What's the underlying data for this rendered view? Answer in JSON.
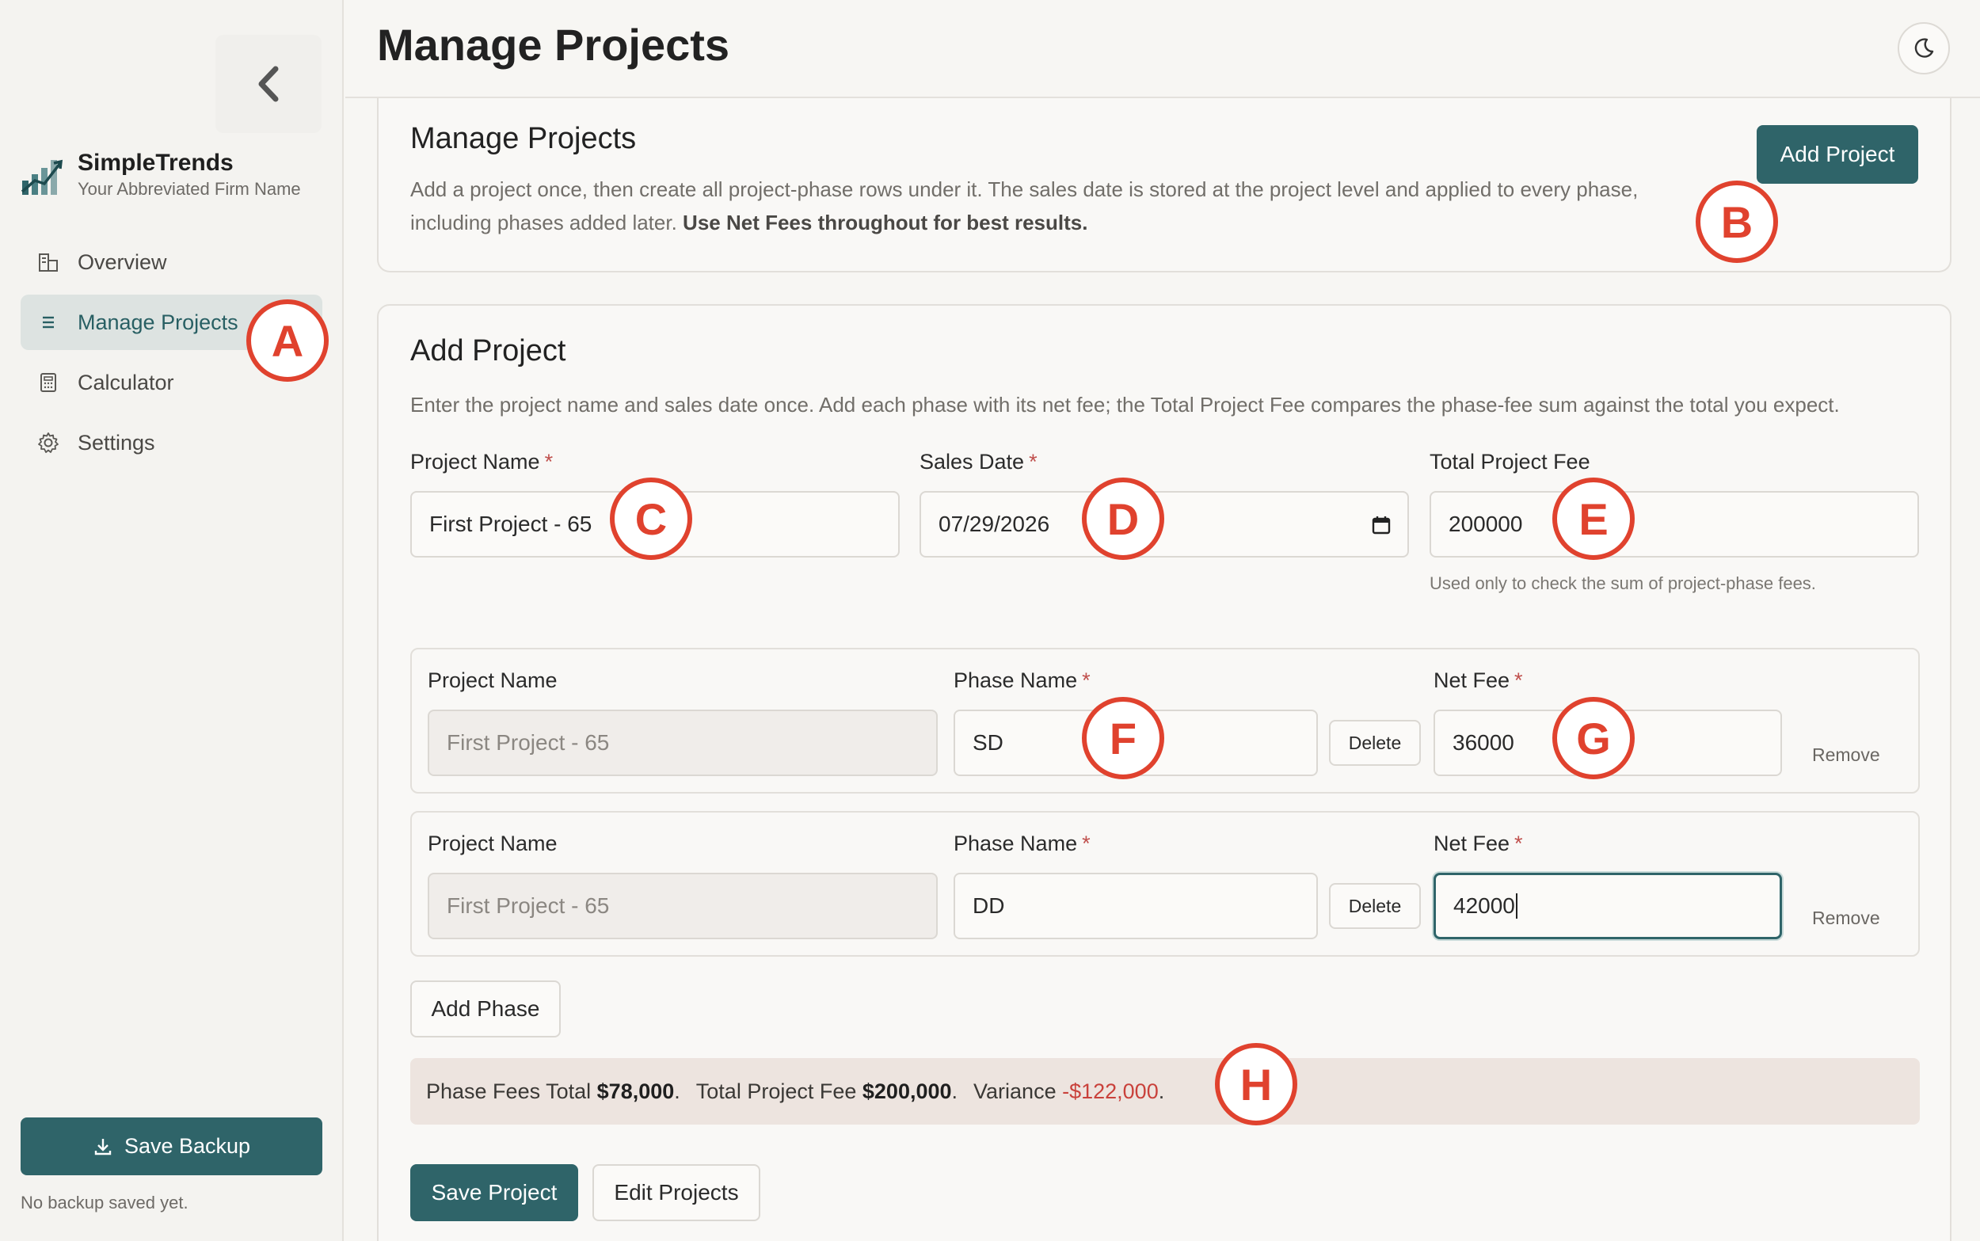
{
  "app": {
    "brand_name": "SimpleTrends",
    "firm_name": "Your Abbreviated Firm Name",
    "page_title": "Manage Projects"
  },
  "sidebar": {
    "items": [
      {
        "label": "Overview",
        "icon": "building-icon",
        "active": false
      },
      {
        "label": "Manage Projects",
        "icon": "list-icon",
        "active": true
      },
      {
        "label": "Calculator",
        "icon": "calculator-icon",
        "active": false
      },
      {
        "label": "Settings",
        "icon": "gear-icon",
        "active": false
      }
    ],
    "save_backup_label": "Save Backup",
    "backup_note": "No backup saved yet."
  },
  "intro_card": {
    "title": "Manage Projects",
    "description": "Add a project once, then create all project-phase rows under it. The sales date is stored at the project level and applied to every phase,",
    "description_line2": "including phases added later.",
    "description_bold": "Use Net Fees throughout for best results.",
    "add_project_label": "Add Project"
  },
  "add_card": {
    "title": "Add Project",
    "description": "Enter the project name and sales date once. Add each phase with its net fee; the Total Project Fee compares the phase-fee sum against the total you expect.",
    "project_name_label": "Project Name",
    "project_name_value": "First Project - 65",
    "sales_date_label": "Sales Date",
    "sales_date_value": "07/29/2026",
    "total_fee_label": "Total Project Fee",
    "total_fee_value": "200000",
    "total_fee_hint": "Used only to check the sum of project-phase fees.",
    "required_mark": "*",
    "phases": [
      {
        "project_label": "Project Name",
        "project_value": "First Project - 65",
        "phase_label": "Phase Name",
        "phase_value": "SD",
        "delete_label": "Delete",
        "fee_label": "Net Fee",
        "fee_value": "36000",
        "remove_label": "Remove"
      },
      {
        "project_label": "Project Name",
        "project_value": "First Project - 65",
        "phase_label": "Phase Name",
        "phase_value": "DD",
        "delete_label": "Delete",
        "fee_label": "Net Fee",
        "fee_value": "42000",
        "remove_label": "Remove"
      }
    ],
    "add_phase_label": "Add Phase",
    "summary": {
      "phase_total_label": "Phase Fees Total",
      "phase_total_value": "$78,000",
      "total_fee_label": "Total Project Fee",
      "total_fee_value": "$200,000",
      "variance_label": "Variance",
      "variance_value": "-$122,000",
      "period": "."
    },
    "save_project_label": "Save Project",
    "edit_projects_label": "Edit Projects"
  },
  "markers": [
    "A",
    "B",
    "C",
    "D",
    "E",
    "F",
    "G",
    "H"
  ],
  "colors": {
    "accent": "#2f6469",
    "negative": "#c9413b",
    "marker": "#e0422e",
    "background": "#f7f6f3"
  }
}
